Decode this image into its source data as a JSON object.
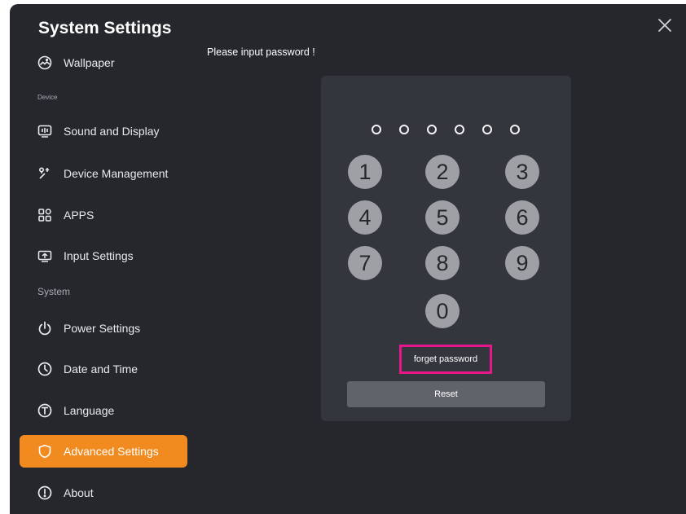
{
  "app": {
    "title": "System Settings"
  },
  "sidebar": {
    "sections": {
      "device": "Device",
      "system": "System"
    },
    "items": [
      {
        "label": "Wallpaper",
        "icon": "wallpaper-icon"
      },
      {
        "label": "Sound and Display",
        "icon": "sound-display-icon"
      },
      {
        "label": "Device Management",
        "icon": "device-management-icon"
      },
      {
        "label": "APPS",
        "icon": "apps-icon"
      },
      {
        "label": "Input Settings",
        "icon": "input-settings-icon"
      },
      {
        "label": "Power Settings",
        "icon": "power-icon"
      },
      {
        "label": "Date and Time",
        "icon": "clock-icon"
      },
      {
        "label": "Language",
        "icon": "language-icon"
      },
      {
        "label": "Advanced Settings",
        "icon": "shield-icon",
        "active": true
      },
      {
        "label": "About",
        "icon": "info-icon"
      }
    ]
  },
  "main": {
    "prompt": "Please input password !",
    "password_length": 6,
    "keys": [
      "1",
      "2",
      "3",
      "4",
      "5",
      "6",
      "7",
      "8",
      "9",
      "0"
    ],
    "forget_label": "forget password",
    "reset_label": "Reset"
  },
  "colors": {
    "background": "#25272d",
    "card": "#33363d",
    "accent": "#f28b1f",
    "key": "#9ea0a6",
    "highlight": "#e8168b",
    "reset_button": "#60636a"
  }
}
